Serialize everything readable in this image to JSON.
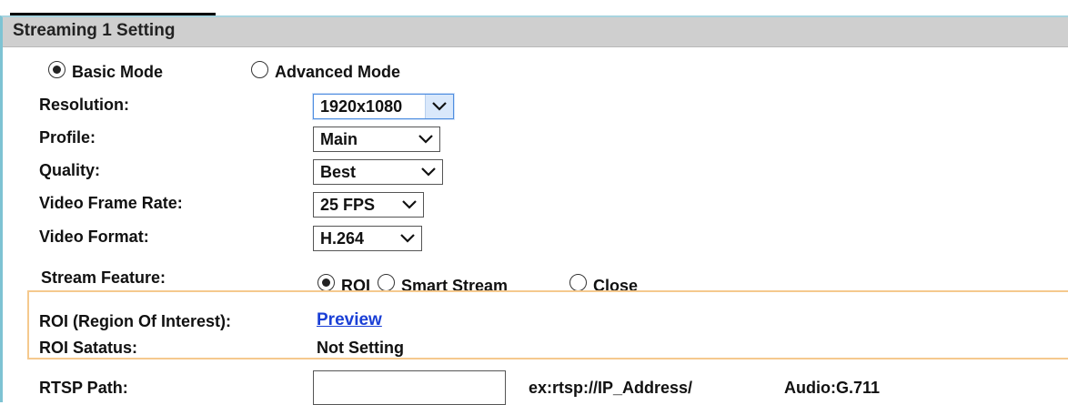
{
  "panel": {
    "title": "Streaming 1 Setting"
  },
  "mode": {
    "basic_label": "Basic Mode",
    "advanced_label": "Advanced Mode",
    "selected": "basic"
  },
  "fields": {
    "resolution": {
      "label": "Resolution:",
      "value": "1920x1080"
    },
    "profile": {
      "label": "Profile:",
      "value": "Main"
    },
    "quality": {
      "label": "Quality:",
      "value": "Best"
    },
    "frame_rate": {
      "label": "Video Frame Rate:",
      "value": "25 FPS"
    },
    "video_format": {
      "label": "Video Format:",
      "value": "H.264"
    }
  },
  "stream_feature": {
    "label": "Stream Feature:",
    "options": [
      "ROI",
      "Smart Stream",
      "Close"
    ],
    "selected": "ROI"
  },
  "roi": {
    "label": "ROI (Region Of Interest):",
    "preview_link": "Preview",
    "status_label": "ROI Satatus:",
    "status_value": "Not Setting"
  },
  "rtsp": {
    "label": "RTSP Path:",
    "value": "",
    "example": "ex:rtsp://IP_Address/",
    "audio": "Audio:G.711"
  },
  "colors": {
    "header_bg": "#cfcfcf",
    "panel_border": "#7ec3d3",
    "roi_border": "#f5c98e",
    "link": "#1a3fd6"
  },
  "icons": {
    "dropdown": "chevron-down-icon"
  }
}
